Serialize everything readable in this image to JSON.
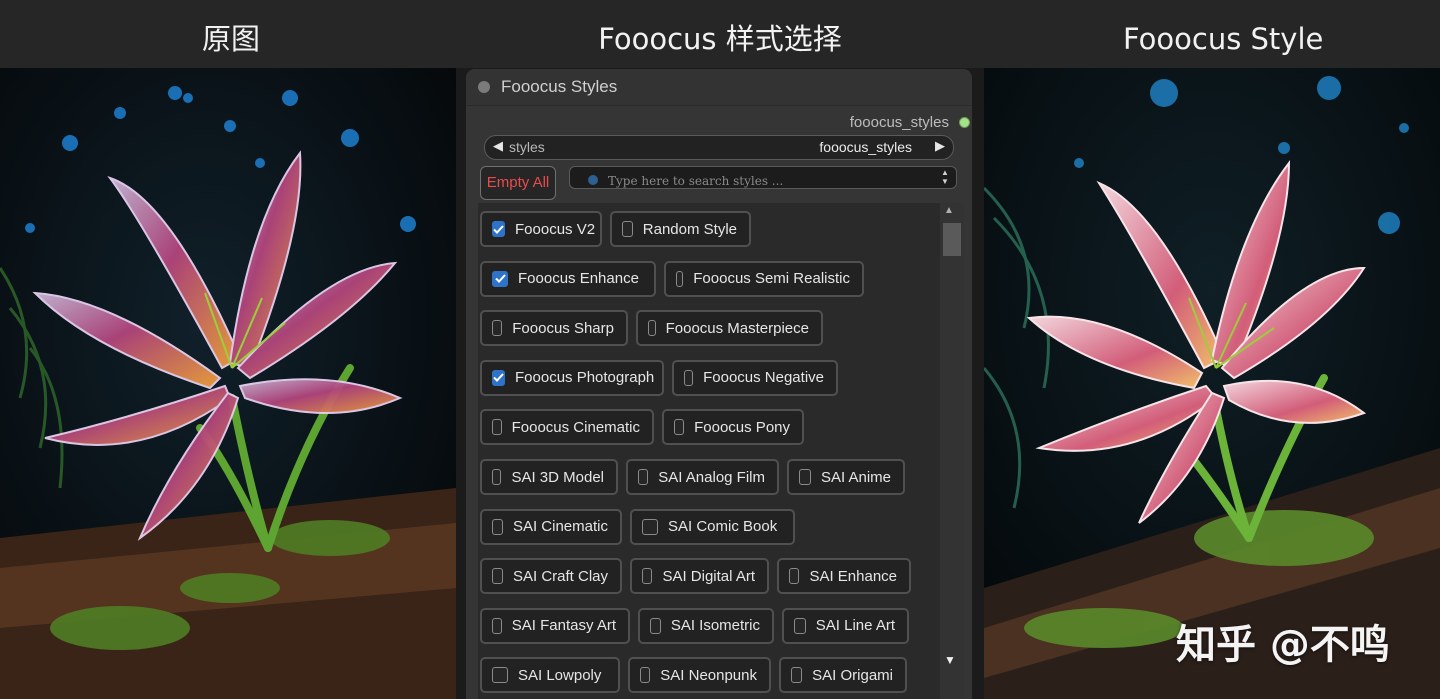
{
  "captions": {
    "left": "原图",
    "middle": "Fooocus 样式选择",
    "right": "Fooocus Style"
  },
  "watermark": "知乎 @不鸣",
  "node": {
    "title": "Fooocus Styles",
    "output_label": "fooocus_styles",
    "output_dot_color": "#a4e28a",
    "combo": {
      "left_arrow": "◀",
      "label": "styles",
      "value": "fooocus_styles",
      "right_arrow": "▶"
    },
    "empty_all_label": "Empty All",
    "search_placeholder": "Type here to search styles ...",
    "scroll_up": "▲",
    "scroll_down": "▼",
    "accent_color": "#2f73c9"
  },
  "styles": [
    {
      "label": "Fooocus V2",
      "checked": true
    },
    {
      "label": "Random Style",
      "checked": false
    },
    {
      "label": "Fooocus Enhance",
      "checked": true
    },
    {
      "label": "Fooocus Semi Realistic",
      "checked": false
    },
    {
      "label": "Fooocus Sharp",
      "checked": false
    },
    {
      "label": "Fooocus Masterpiece",
      "checked": false
    },
    {
      "label": "Fooocus Photograph",
      "checked": true
    },
    {
      "label": "Fooocus Negative",
      "checked": false
    },
    {
      "label": "Fooocus Cinematic",
      "checked": false
    },
    {
      "label": "Fooocus Pony",
      "checked": false
    },
    {
      "label": "SAI 3D Model",
      "checked": false
    },
    {
      "label": "SAI Analog Film",
      "checked": false
    },
    {
      "label": "SAI Anime",
      "checked": false
    },
    {
      "label": "SAI Cinematic",
      "checked": false
    },
    {
      "label": "SAI Comic Book",
      "checked": false
    },
    {
      "label": "SAI Craft Clay",
      "checked": false
    },
    {
      "label": "SAI Digital Art",
      "checked": false
    },
    {
      "label": "SAI Enhance",
      "checked": false
    },
    {
      "label": "SAI Fantasy Art",
      "checked": false
    },
    {
      "label": "SAI Isometric",
      "checked": false
    },
    {
      "label": "SAI Line Art",
      "checked": false
    },
    {
      "label": "SAI Lowpoly",
      "checked": false
    },
    {
      "label": "SAI Neonpunk",
      "checked": false
    },
    {
      "label": "SAI Origami",
      "checked": false
    }
  ]
}
